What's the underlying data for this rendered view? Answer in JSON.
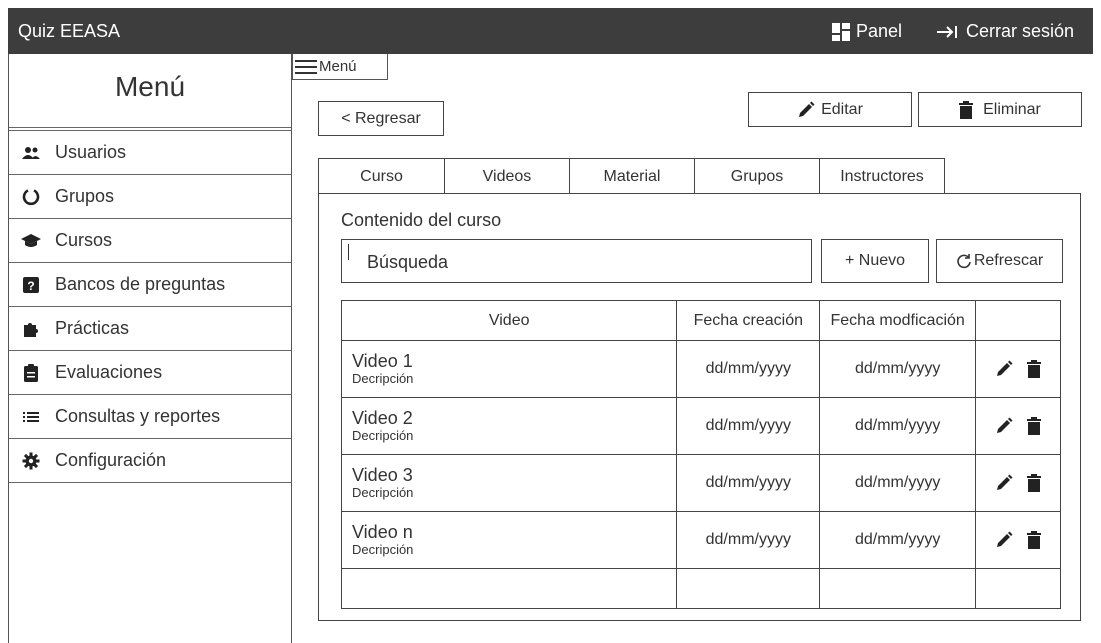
{
  "topbar": {
    "title": "Quiz EEASA",
    "panel_label": "Panel",
    "logout_label": "Cerrar sesión"
  },
  "sidebar": {
    "title": "Menú",
    "items": [
      {
        "label": "Usuarios",
        "icon": "users-icon"
      },
      {
        "label": "Grupos",
        "icon": "circle-notch-icon"
      },
      {
        "label": "Cursos",
        "icon": "graduation-cap-icon"
      },
      {
        "label": "Bancos de preguntas",
        "icon": "question-square-icon"
      },
      {
        "label": "Prácticas",
        "icon": "puzzle-icon"
      },
      {
        "label": "Evaluaciones",
        "icon": "clipboard-icon"
      },
      {
        "label": "Consultas y reportes",
        "icon": "list-icon"
      },
      {
        "label": "Configuración",
        "icon": "gear-icon"
      }
    ]
  },
  "menu_toggle": "Menú",
  "actions": {
    "back": "< Regresar",
    "edit": "Editar",
    "delete": "Eliminar"
  },
  "tabs": [
    "Curso",
    "Videos",
    "Material",
    "Grupos",
    "Instructores"
  ],
  "content": {
    "title": "Contenido del curso",
    "search_placeholder": "Búsqueda",
    "new_label": "+ Nuevo",
    "refresh_label": "Refrescar"
  },
  "table": {
    "headers": [
      "Video",
      "Fecha creación",
      "Fecha modficación",
      ""
    ],
    "rows": [
      {
        "name": "Video 1",
        "desc": "Decripción",
        "created": "dd/mm/yyyy",
        "modified": "dd/mm/yyyy"
      },
      {
        "name": "Video 2",
        "desc": "Decripción",
        "created": "dd/mm/yyyy",
        "modified": "dd/mm/yyyy"
      },
      {
        "name": "Video 3",
        "desc": "Decripción",
        "created": "dd/mm/yyyy",
        "modified": "dd/mm/yyyy"
      },
      {
        "name": "Video n",
        "desc": "Decripción",
        "created": "dd/mm/yyyy",
        "modified": "dd/mm/yyyy"
      }
    ]
  },
  "colors": {
    "topbar_bg": "#3d3d3d",
    "text": "#333333"
  }
}
